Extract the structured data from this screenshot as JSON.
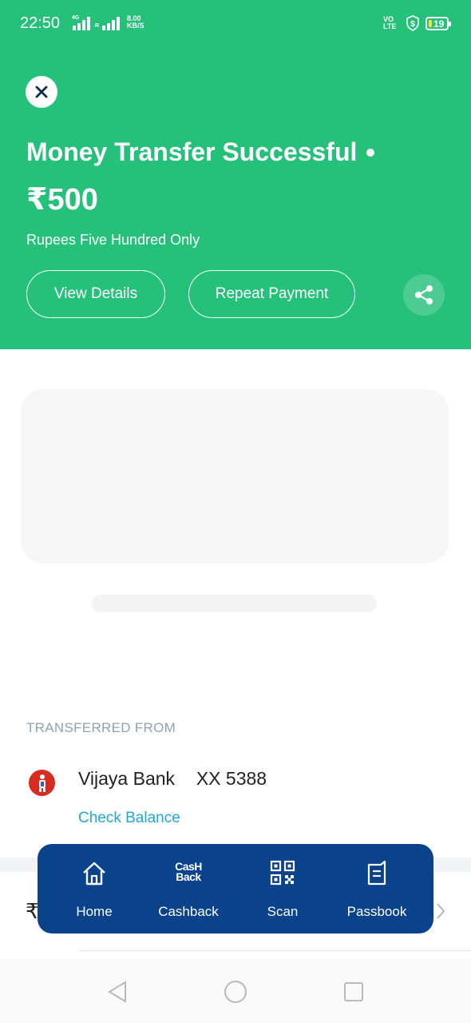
{
  "status_bar": {
    "time": "22:50",
    "net1_label": "4G",
    "net2_label": "R",
    "speed_value": "8.00",
    "speed_unit": "KB/S",
    "volte_top": "VO",
    "volte_bottom": "LTE",
    "battery": "19"
  },
  "header": {
    "title": "Money Transfer Successful",
    "amount": "₹500",
    "amount_words": "Rupees Five Hundred Only",
    "view_details_label": "View Details",
    "repeat_payment_label": "Repeat Payment",
    "background_color": "#25c17b"
  },
  "transfer": {
    "section_label": "TRANSFERRED FROM",
    "bank_name": "Vijaya Bank",
    "account_masked": "XX 5388",
    "check_balance_label": "Check Balance",
    "partial_row_symbol": "₹"
  },
  "bottom_nav": {
    "background_color": "#0a438c",
    "items": [
      {
        "label": "Home",
        "icon": "home-icon"
      },
      {
        "label": "Cashback",
        "icon": "cashback-icon",
        "icon_text_top": "CasH",
        "icon_text_bottom": "Back"
      },
      {
        "label": "Scan",
        "icon": "qr-scan-icon"
      },
      {
        "label": "Passbook",
        "icon": "passbook-icon"
      }
    ]
  },
  "system_nav": {
    "icons": [
      "back-icon",
      "home-circle-icon",
      "recents-icon"
    ]
  }
}
